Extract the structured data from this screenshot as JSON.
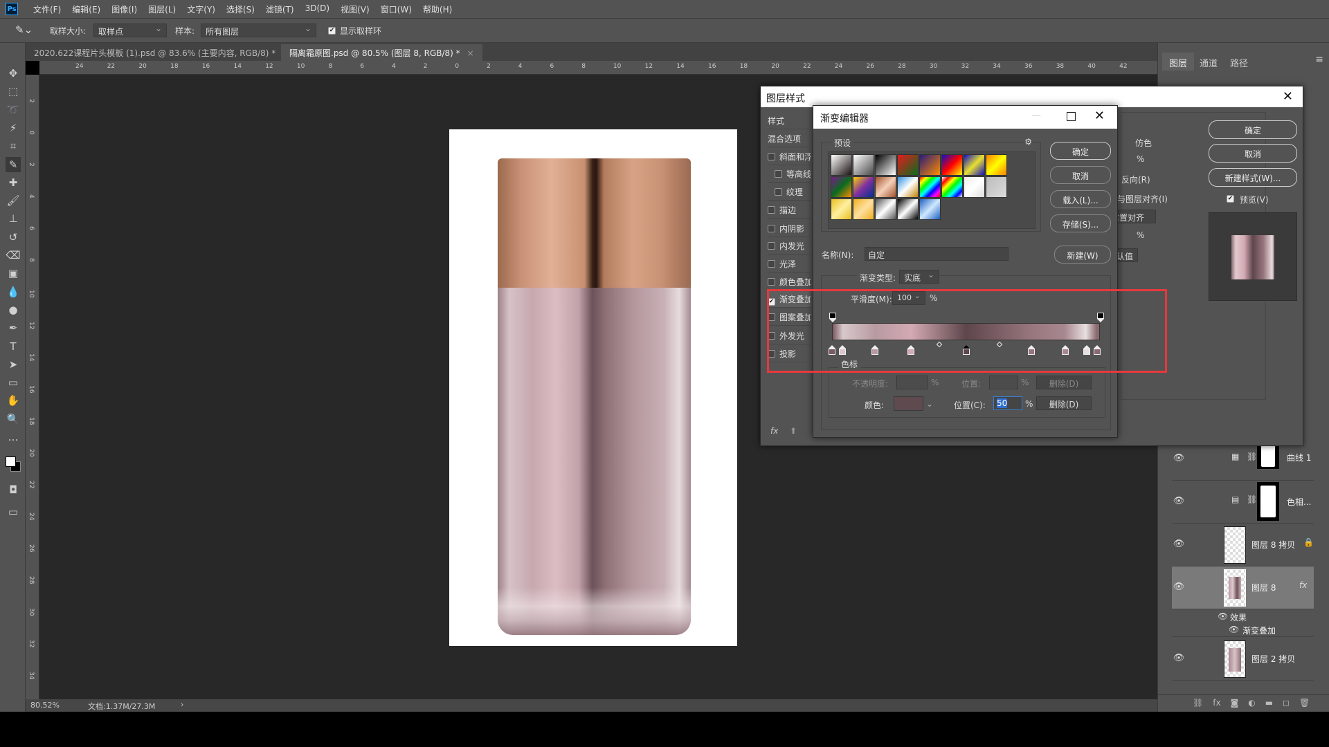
{
  "app": {
    "logo": "Ps"
  },
  "menu": [
    "文件(F)",
    "编辑(E)",
    "图像(I)",
    "图层(L)",
    "文字(Y)",
    "选择(S)",
    "滤镜(T)",
    "3D(D)",
    "视图(V)",
    "窗口(W)",
    "帮助(H)"
  ],
  "options": {
    "sample_size_label": "取样大小:",
    "sample_size_value": "取样点",
    "sample_label": "样本:",
    "sample_value": "所有图层",
    "show_ring_label": "显示取样环",
    "show_ring_checked": true
  },
  "doc_tabs": [
    {
      "label": "2020.622课程片头模板 (1).psd @ 83.6% (主要内容, RGB/8) *",
      "close": "×",
      "active": false
    },
    {
      "label": "隔离霜原图.psd @ 80.5% (图层 8, RGB/8) *",
      "close": "×",
      "active": true
    }
  ],
  "rulers": {
    "horizontal": [
      "24",
      "22",
      "20",
      "18",
      "16",
      "14",
      "12",
      "10",
      "8",
      "6",
      "4",
      "2",
      "0",
      "2",
      "4",
      "6",
      "8",
      "10",
      "12",
      "14",
      "16",
      "18",
      "20",
      "22",
      "24",
      "26",
      "28",
      "30",
      "32",
      "34",
      "36",
      "38",
      "40",
      "42"
    ],
    "vertical": [
      "2",
      "0",
      "2",
      "4",
      "6",
      "8",
      "10",
      "12",
      "14",
      "16",
      "18",
      "20",
      "22",
      "24",
      "26",
      "28",
      "30",
      "32",
      "34"
    ]
  },
  "status": {
    "zoom": "80.52%",
    "doc": "文档:1.37M/27.3M",
    "arrow": "›"
  },
  "layers_panel": {
    "tabs": [
      "图层",
      "通道",
      "路径"
    ],
    "layers": [
      {
        "name": "曲线 1",
        "type": "adjustment",
        "icon": "curves-icon"
      },
      {
        "name": "色相...",
        "type": "adjustment",
        "icon": "hue-saturation-icon"
      },
      {
        "name": "图层 8 拷贝",
        "type": "pixel",
        "locked": true
      },
      {
        "name": "图层 8",
        "type": "pixel",
        "selected": true,
        "fx": "fx"
      },
      {
        "name": "图层 2 拷贝",
        "type": "pixel"
      }
    ],
    "effects_label": "效果",
    "effect_item": "渐变叠加",
    "bottom_icons": [
      "link-icon",
      "fx-icon",
      "mask-icon",
      "adjustment-icon",
      "folder-icon",
      "new-layer-icon",
      "trash-icon"
    ]
  },
  "layer_style": {
    "title": "图层样式",
    "list": [
      {
        "label": "样式"
      },
      {
        "label": "混合选项"
      },
      {
        "label": "斜面和浮雕",
        "checkbox": true,
        "checked": false
      },
      {
        "label": "等高线",
        "checkbox": true,
        "checked": false,
        "indent": true
      },
      {
        "label": "纹理",
        "checkbox": true,
        "checked": false,
        "indent": true
      },
      {
        "label": "描边",
        "checkbox": true,
        "checked": false
      },
      {
        "label": "内阴影",
        "checkbox": true,
        "checked": false
      },
      {
        "label": "内发光",
        "checkbox": true,
        "checked": false
      },
      {
        "label": "光泽",
        "checkbox": true,
        "checked": false
      },
      {
        "label": "颜色叠加",
        "checkbox": true,
        "checked": false
      },
      {
        "label": "渐变叠加",
        "checkbox": true,
        "checked": true
      },
      {
        "label": "图案叠加",
        "checkbox": true,
        "checked": false
      },
      {
        "label": "外发光",
        "checkbox": true,
        "checked": false
      },
      {
        "label": "投影",
        "checkbox": true,
        "checked": false
      }
    ],
    "partial_labels": [
      "仿色",
      "%",
      "反向(R)",
      "与图层对齐(I)",
      "重置对齐",
      "%",
      "设置为默认值"
    ],
    "ok": "确定",
    "cancel": "取消",
    "new_style": "新建样式(W)...",
    "preview_label": "预览(V)",
    "preview_checked": true,
    "fx": "fx"
  },
  "gradient_editor": {
    "title": "渐变编辑器",
    "presets_label": "预设",
    "presets": [
      "linear-gradient(135deg,#fff,#1a1010)",
      "linear-gradient(135deg,#fff,rgba(255,255,255,0))",
      "linear-gradient(135deg,#000,#fff)",
      "linear-gradient(135deg,#e51c1c,#0a6b1e)",
      "linear-gradient(135deg,#2a1a7a,#ff8c00)",
      "linear-gradient(135deg,#1010c0,#f00 50%,#ff0)",
      "linear-gradient(135deg,#1010c0,#e8e030 50%,#1010c0)",
      "linear-gradient(135deg,#ff8000,#ff0 50%,#ff8000)",
      "linear-gradient(135deg,#7a1a8a,#0a6b1e 50%,#ff8c00)",
      "linear-gradient(135deg,#ffd000,#8030a0 50%,#003090)",
      "linear-gradient(135deg,#a0522d,#f5d0b8 50%,#a0522d)",
      "linear-gradient(135deg,#3090e0,#fff 50%,#c08000)",
      "linear-gradient(135deg,#f00,#ff0,#0f0,#0ff,#00f,#f0f,#f00)",
      "linear-gradient(135deg,#fff,#f00,#ff0,#0f0,#0ff,#00f,#fff)",
      "linear-gradient(135deg,#eee,#fff 50%,#ddd)",
      "linear-gradient(135deg,#bbb,#ddd)",
      "linear-gradient(135deg,#e8c020,#fff0a0 50%,#e8c020)",
      "linear-gradient(135deg,#f0b020,#ffe0a0 50%,#f0b020)",
      "linear-gradient(135deg,#555,#fff 50%,#555)",
      "linear-gradient(135deg,#000,#fff 50%,#000)",
      "linear-gradient(135deg,#2060c0,#d0e8ff 50%,#2060c0)"
    ],
    "ok": "确定",
    "cancel": "取消",
    "load": "载入(L)...",
    "save": "存储(S)...",
    "new": "新建(W)",
    "name_label": "名称(N):",
    "name_value": "自定",
    "type_label": "渐变类型:",
    "type_value": "实底",
    "smooth_label": "平滑度(M):",
    "smooth_value": "100",
    "percent": "%",
    "stops_group": "色标",
    "opacity_label": "不透明度:",
    "position_label": "位置:",
    "delete": "删除(D)",
    "color_label": "颜色:",
    "color_position_label": "位置(C):",
    "color_position_value": "50",
    "delete_active": "删除(D)",
    "selected_color": "#5e4a4f",
    "color_stops": [
      {
        "pos": 0,
        "color": "#7a5a62"
      },
      {
        "pos": 3.8,
        "color": "#d8c8cc"
      },
      {
        "pos": 16,
        "color": "#b89aa2"
      },
      {
        "pos": 29.5,
        "color": "#d4aab3"
      },
      {
        "pos": 50,
        "color": "#5e464c",
        "selected": true
      },
      {
        "pos": 74.5,
        "color": "#98767d"
      },
      {
        "pos": 87,
        "color": "#a88890"
      },
      {
        "pos": 95,
        "color": "#e8dfe1"
      },
      {
        "pos": 99,
        "color": "#8a6a70"
      }
    ],
    "midpoints": [
      40,
      62.5
    ],
    "opacity_stops": [
      0,
      100
    ]
  },
  "highlight_color": "#e8383d"
}
